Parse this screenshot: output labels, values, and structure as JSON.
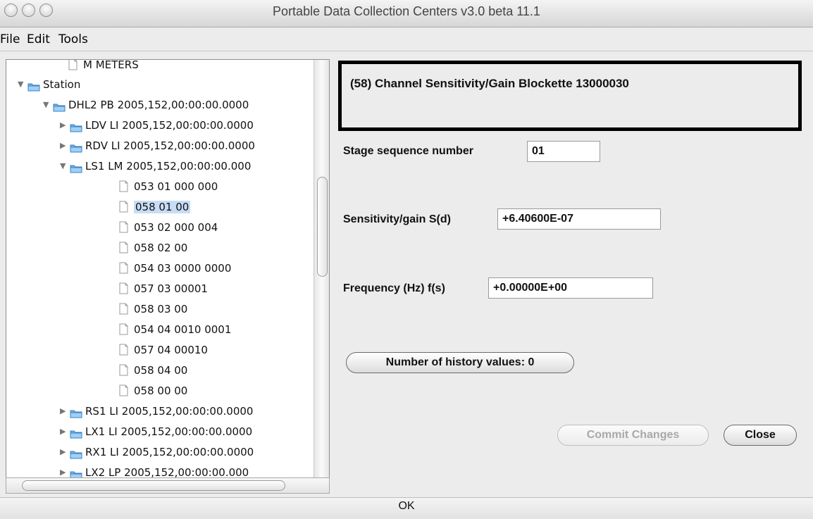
{
  "window": {
    "title": "Portable Data Collection Centers v3.0 beta 11.1"
  },
  "menu": [
    "File",
    "Edit",
    "Tools"
  ],
  "tree": {
    "rows": [
      {
        "label": "M METERS",
        "expanded": null,
        "icon": "document-icon",
        "selected": false
      },
      {
        "label": "Station",
        "expanded": true,
        "icon": "folder-icon",
        "selected": false
      },
      {
        "label": "DHL2 PB 2005,152,00:00:00.0000",
        "expanded": true,
        "icon": "folder-icon",
        "selected": false
      },
      {
        "label": "LDV LI 2005,152,00:00:00.0000",
        "expanded": false,
        "icon": "folder-icon",
        "selected": false
      },
      {
        "label": "RDV LI 2005,152,00:00:00.0000",
        "expanded": false,
        "icon": "folder-icon",
        "selected": false
      },
      {
        "label": "LS1 LM 2005,152,00:00:00.000",
        "expanded": true,
        "icon": "folder-icon",
        "selected": false
      },
      {
        "label": "053 01 000 000",
        "expanded": null,
        "icon": "document-icon",
        "selected": false
      },
      {
        "label": "058 01 00",
        "expanded": null,
        "icon": "document-icon",
        "selected": true
      },
      {
        "label": "053 02 000 004",
        "expanded": null,
        "icon": "document-icon",
        "selected": false
      },
      {
        "label": "058 02 00",
        "expanded": null,
        "icon": "document-icon",
        "selected": false
      },
      {
        "label": "054 03 0000 0000",
        "expanded": null,
        "icon": "document-icon",
        "selected": false
      },
      {
        "label": "057 03 00001",
        "expanded": null,
        "icon": "document-icon",
        "selected": false
      },
      {
        "label": "058 03 00",
        "expanded": null,
        "icon": "document-icon",
        "selected": false
      },
      {
        "label": "054 04 0010 0001",
        "expanded": null,
        "icon": "document-icon",
        "selected": false
      },
      {
        "label": "057 04 00010",
        "expanded": null,
        "icon": "document-icon",
        "selected": false
      },
      {
        "label": "058 04 00",
        "expanded": null,
        "icon": "document-icon",
        "selected": false
      },
      {
        "label": "058 00 00",
        "expanded": null,
        "icon": "document-icon",
        "selected": false
      },
      {
        "label": "RS1 LI 2005,152,00:00:00.0000",
        "expanded": false,
        "icon": "folder-icon",
        "selected": false
      },
      {
        "label": "LX1 LI 2005,152,00:00:00.0000",
        "expanded": false,
        "icon": "folder-icon",
        "selected": false
      },
      {
        "label": "RX1 LI 2005,152,00:00:00.0000",
        "expanded": false,
        "icon": "folder-icon",
        "selected": false
      },
      {
        "label": "LX2 LP 2005,152,00:00:00.000",
        "expanded": false,
        "icon": "folder-icon",
        "selected": false
      }
    ]
  },
  "detail": {
    "header": "(58) Channel Sensitivity/Gain Blockette 13000030",
    "stage_label": "Stage sequence number",
    "stage_value": "01",
    "sensitivity_label": "Sensitivity/gain S(d)",
    "sensitivity_value": "+6.40600E-07",
    "frequency_label": "Frequency (Hz) f(s)",
    "frequency_value": "+0.00000E+00",
    "history_button": "Number of history values: 0",
    "commit_button": "Commit Changes",
    "close_button": "Close"
  },
  "status": {
    "text": "OK"
  }
}
